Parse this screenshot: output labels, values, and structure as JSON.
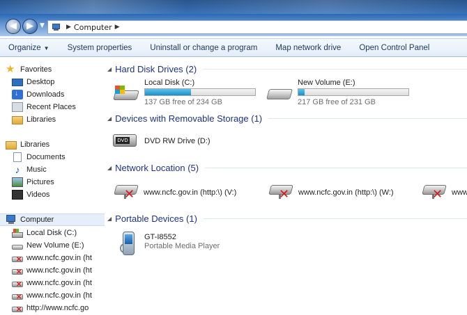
{
  "address": {
    "crumbs": [
      "Computer"
    ]
  },
  "toolbar": {
    "organize": "Organize",
    "system_properties": "System properties",
    "uninstall": "Uninstall or change a program",
    "map_drive": "Map network drive",
    "control_panel": "Open Control Panel"
  },
  "nav": {
    "favorites": "Favorites",
    "desktop": "Desktop",
    "downloads": "Downloads",
    "recent_places": "Recent Places",
    "libraries_fav": "Libraries",
    "libraries": "Libraries",
    "documents": "Documents",
    "music": "Music",
    "pictures": "Pictures",
    "videos": "Videos",
    "computer": "Computer",
    "local_disk": "Local Disk (C:)",
    "new_volume": "New Volume (E:)",
    "net1": "www.ncfc.gov.in (ht",
    "net2": "www.ncfc.gov.in (ht",
    "net3": "www.ncfc.gov.in (ht",
    "net4": "www.ncfc.gov.in (ht",
    "net5": "http://www.ncfc.go"
  },
  "groups": {
    "hdd": "Hard Disk Drives (2)",
    "removable": "Devices with Removable Storage (1)",
    "network": "Network Location (5)",
    "portable": "Portable Devices (1)"
  },
  "drives": {
    "c_name": "Local Disk (C:)",
    "c_free": "137 GB free of 234 GB",
    "c_used_fraction": 0.415,
    "e_name": "New Volume (E:)",
    "e_free": "217 GB free of 231 GB",
    "e_used_fraction": 0.06,
    "dvd_name": "DVD RW Drive (D:)",
    "dvd_label": "DVD"
  },
  "network": {
    "v": "www.ncfc.gov.in (http:\\) (V:)",
    "w": "www.ncfc.gov.in (http:\\) (W:)",
    "third": "www"
  },
  "portable": {
    "name": "GT-I8552",
    "type": "Portable Media Player"
  }
}
